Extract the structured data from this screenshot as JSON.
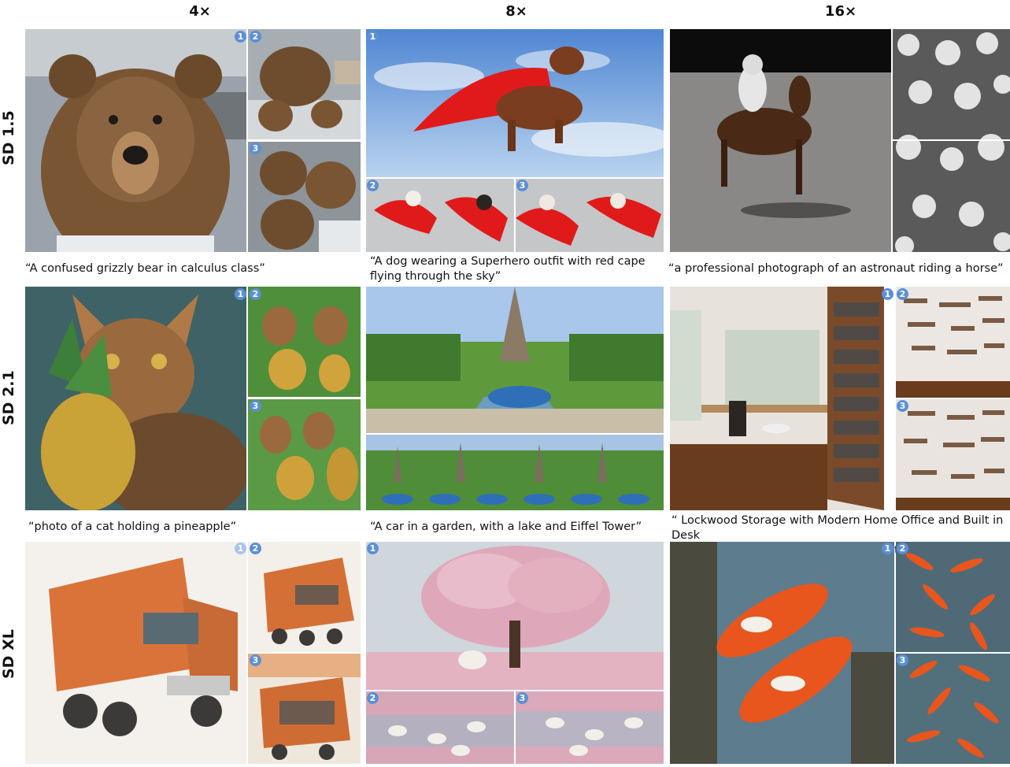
{
  "columns": [
    "4×",
    "8×",
    "16×"
  ],
  "rows": [
    "SD 1.5",
    "SD 2.1",
    "SD XL"
  ],
  "captions": {
    "r1c1": "“A confused grizzly bear in calculus class”",
    "r1c2": "“A dog wearing a Superhero outfit with red cape\nflying through the sky”",
    "r1c3": "“a professional photograph of an astronaut riding a horse”",
    "r2c1": "“photo of a cat holding a pineapple”",
    "r2c2": "“A car in a garden, with a lake and Eiffel Tower”",
    "r2c3": "“ Lockwood Storage with Modern Home Office and Built in Desk\nBuilt in Storage Casement Window Casters Dark Wood Floor”"
  },
  "badges": [
    "1",
    "2",
    "3"
  ],
  "tiles": {
    "bear_main": "grizzly-bear-classroom-image",
    "bear_alt2": "bears-classroom-image",
    "bear_alt3": "three-bears-image",
    "dog_main": "dog-red-cape-flying-image",
    "dog_alt2": "dogs-red-capes-image",
    "dog_alt3": "dogs-red-capes-image",
    "astro_main": "astronaut-horse-moon-image",
    "astro_alt": "astronaut-repeated-pattern-image",
    "cat_main": "cat-pineapple-image",
    "cat_alt2": "cats-pineapples-image",
    "cat_alt3": "cats-pineapples-image",
    "car_main": "car-eiffel-tower-garden-image",
    "car_alt": "cars-eiffel-towers-image",
    "office_main": "home-office-library-image",
    "office_alt2": "shelves-pattern-image",
    "office_alt3": "shelves-pattern-image",
    "truck_main": "watercolor-garbage-truck-image",
    "truck_alt2": "watercolor-trucks-image",
    "truck_alt3": "watercolor-trucks-image",
    "tree_main": "cherry-blossom-tree-image",
    "tree_alt2": "sheep-pink-field-image",
    "tree_alt3": "sheep-pink-field-image",
    "koi_main": "koi-fish-painting-image",
    "koi_alt2": "koi-school-image",
    "koi_alt3": "koi-school-image"
  },
  "colors": {
    "badge": "#5b8fd6",
    "bear": "#7a5533",
    "cape": "#e01a1a",
    "sky": "#6f9fd8",
    "moon": "#8a8886",
    "grass": "#5e9a3c",
    "pink": "#e6b5c4",
    "orange": "#d9733a",
    "koi": "#e8561e",
    "water": "#5d7c8e"
  }
}
